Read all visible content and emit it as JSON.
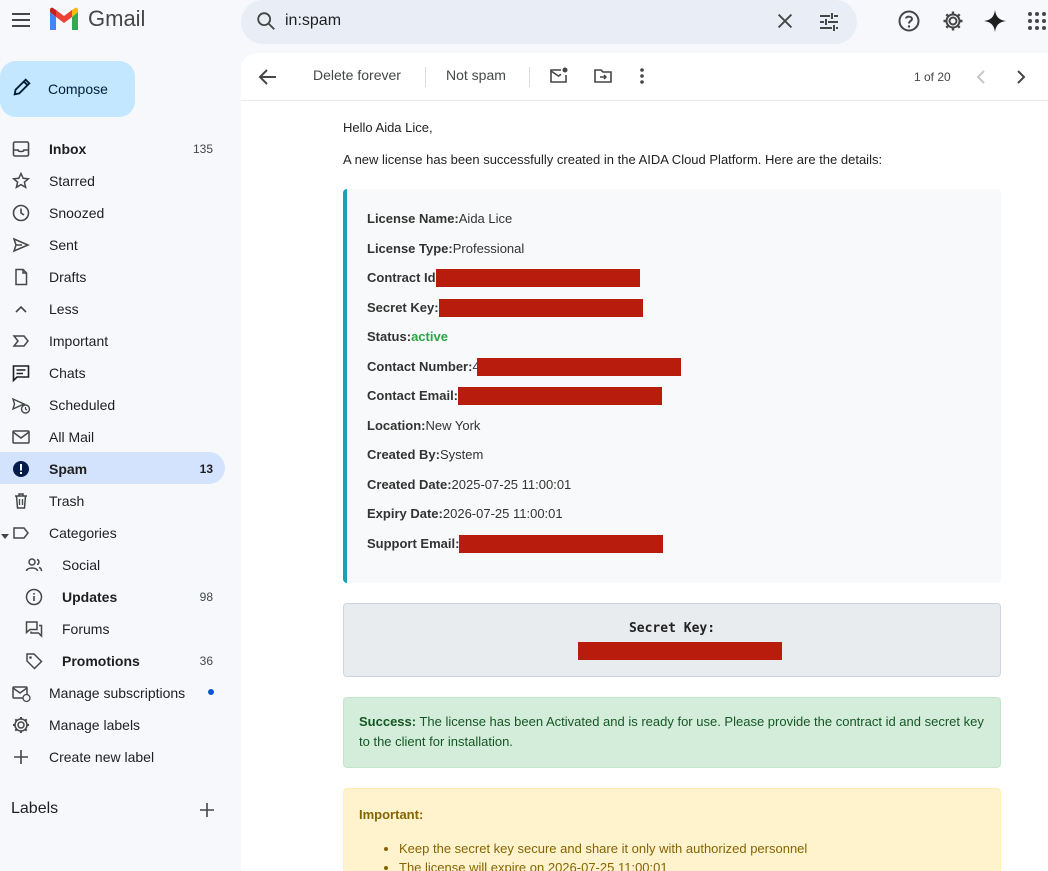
{
  "app": {
    "name": "Gmail"
  },
  "search": {
    "value": "in:spam"
  },
  "compose": {
    "label": "Compose"
  },
  "sidebar": {
    "items": [
      {
        "label": "Inbox",
        "count": "135",
        "icon": "inbox-icon"
      },
      {
        "label": "Starred",
        "count": "",
        "icon": "star-icon"
      },
      {
        "label": "Snoozed",
        "count": "",
        "icon": "clock-icon"
      },
      {
        "label": "Sent",
        "count": "",
        "icon": "send-icon"
      },
      {
        "label": "Drafts",
        "count": "",
        "icon": "draft-icon"
      },
      {
        "label": "Less",
        "count": "",
        "icon": "chevron-up-icon"
      },
      {
        "label": "Important",
        "count": "",
        "icon": "important-icon"
      },
      {
        "label": "Chats",
        "count": "",
        "icon": "chat-icon"
      },
      {
        "label": "Scheduled",
        "count": "",
        "icon": "scheduled-send-icon"
      },
      {
        "label": "All Mail",
        "count": "",
        "icon": "all-mail-icon"
      },
      {
        "label": "Spam",
        "count": "13",
        "icon": "spam-icon"
      },
      {
        "label": "Trash",
        "count": "",
        "icon": "trash-icon"
      },
      {
        "label": "Categories",
        "count": "",
        "icon": "label-icon"
      },
      {
        "label": "Social",
        "count": "",
        "icon": "people-icon"
      },
      {
        "label": "Updates",
        "count": "98",
        "icon": "info-icon"
      },
      {
        "label": "Forums",
        "count": "",
        "icon": "forum-icon"
      },
      {
        "label": "Promotions",
        "count": "36",
        "icon": "tag-icon"
      },
      {
        "label": "Manage subscriptions",
        "count": "",
        "icon": "manage-subscriptions-icon"
      },
      {
        "label": "Manage labels",
        "count": "",
        "icon": "gear-icon"
      },
      {
        "label": "Create new label",
        "count": "",
        "icon": "plus-icon"
      }
    ],
    "labels_header": "Labels"
  },
  "toolbar": {
    "delete_forever": "Delete forever",
    "not_spam": "Not spam",
    "pager": "1 of 20"
  },
  "email": {
    "greeting": "Hello Aida Lice,",
    "intro": "A new license has been successfully created in the AIDA Cloud Platform. Here are the details:",
    "fields": {
      "license_name_label": "License Name:",
      "license_name": "Aida Lice",
      "license_type_label": "License Type:",
      "license_type": "Professional",
      "contract_id_label": "Contract Id",
      "secret_key_label": "Secret Key:",
      "status_label": "Status:",
      "status": "active",
      "contact_number_label": "Contact Number:",
      "contact_number_visible": "4",
      "contact_email_label": "Contact Email:",
      "location_label": "Location:",
      "location": "New York",
      "created_by_label": "Created By:",
      "created_by": "System",
      "created_date_label": "Created Date:",
      "created_date": "2025-07-25 11:00:01",
      "expiry_date_label": "Expiry Date:",
      "expiry_date": "2026-07-25 11:00:01",
      "support_email_label": "Support Email:"
    },
    "secret_key_box_label": "Secret Key:",
    "success_label": "Success:",
    "success_text": " The license has been Activated and is ready for use. Please provide the contract id and secret key to the client for installation.",
    "important_title": "Important:",
    "important_items": [
      "Keep the secret key secure and share it only with authorized personnel",
      "The license will expire on 2026-07-25 11:00:01"
    ]
  },
  "colors": {
    "accent": "#0b57d0",
    "selected_bg": "#d3e3fd",
    "compose_bg": "#c2e7ff",
    "redaction": "#b71c0c",
    "status_active": "#28a745",
    "card_border": "#17a2b8"
  }
}
